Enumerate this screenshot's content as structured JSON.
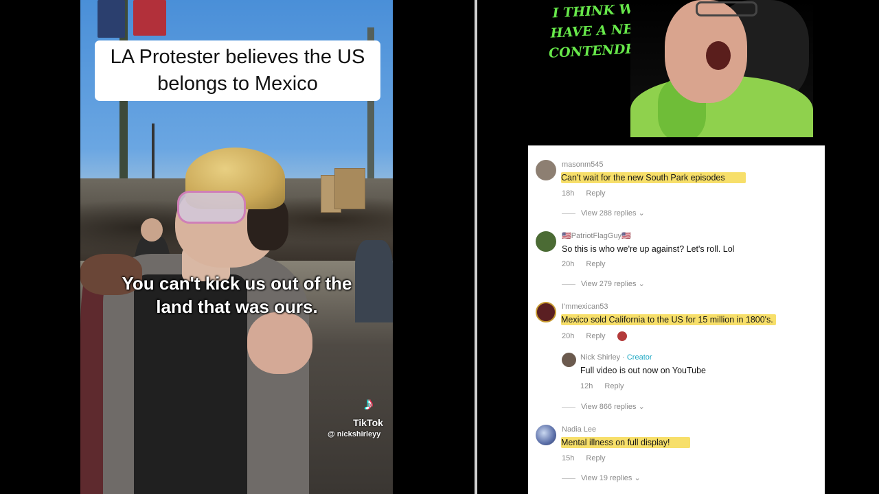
{
  "video": {
    "title": "LA Protester believes the US belongs to Mexico",
    "caption": "You can't kick us out of the land that was ours.",
    "watermark_brand": "TikTok",
    "watermark_handle": "@ nickshirleyy"
  },
  "meme": {
    "text": "I THINK WE HAVE A NEW CONTENDER!"
  },
  "comments": [
    {
      "user": "masonm545",
      "text": "Can't wait for the new South Park episodes",
      "time": "18h",
      "reply_label": "Reply",
      "view_replies": "View 288 replies",
      "highlighted": true
    },
    {
      "user": "🇺🇸PatriotFlagGuy🇺🇸",
      "text": "So this is who we're up against? Let's roll. Lol",
      "time": "20h",
      "reply_label": "Reply",
      "view_replies": "View 279 replies",
      "highlighted": false
    },
    {
      "user": "I'mmexican53",
      "text": "Mexico sold California to the US for 15 million in 1800's.",
      "time": "20h",
      "reply_label": "Reply",
      "highlighted": true,
      "reply": {
        "user": "Nick Shirley",
        "badge": "Creator",
        "text": "Full video is out now on YouTube",
        "time": "12h",
        "reply_label": "Reply"
      },
      "view_replies": "View 866 replies"
    },
    {
      "user": "Nadia Lee",
      "text": "Mental illness on full display!",
      "time": "15h",
      "reply_label": "Reply",
      "view_replies": "View 19 replies",
      "highlighted": true
    }
  ],
  "colors": {
    "meme_text": "#67e84a",
    "highlight": "#f7df6a",
    "creator_badge": "#20a9c4"
  }
}
